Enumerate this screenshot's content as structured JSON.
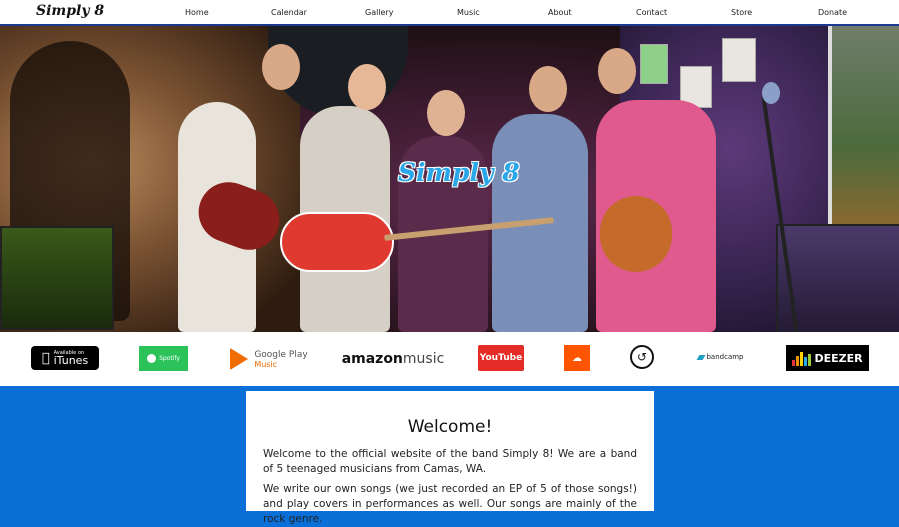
{
  "nav": {
    "logo": "Simply 8",
    "items": [
      "Home",
      "Calendar",
      "Gallery",
      "Music",
      "About",
      "Contact",
      "Store",
      "Donate"
    ]
  },
  "hero": {
    "title": "Simply 8"
  },
  "services": {
    "itunes_small": "Available on",
    "itunes": "iTunes",
    "spotify": "Spotify",
    "google_play": "Google Play",
    "google_play_sub": "Music",
    "amazon_a": "amazon",
    "amazon_b": "music",
    "youtube": "YouTube",
    "bandcamp": "bandcamp",
    "deezer": "DEEZER"
  },
  "content": {
    "heading": "Welcome!",
    "paragraph1": "Welcome to the official website of the band Simply 8! We are a band of 5 teenaged musicians from Camas, WA.",
    "paragraph2": "We write our own songs (we just recorded an EP of 5 of those songs!) and play covers in performances as well. Our songs are mainly of the rock genre."
  },
  "colors": {
    "background": "#0a6fd6",
    "hero_title": "#2aa7e8",
    "spotify": "#2bc25a",
    "youtube": "#e52d27",
    "soundcloud": "#ff5500"
  }
}
